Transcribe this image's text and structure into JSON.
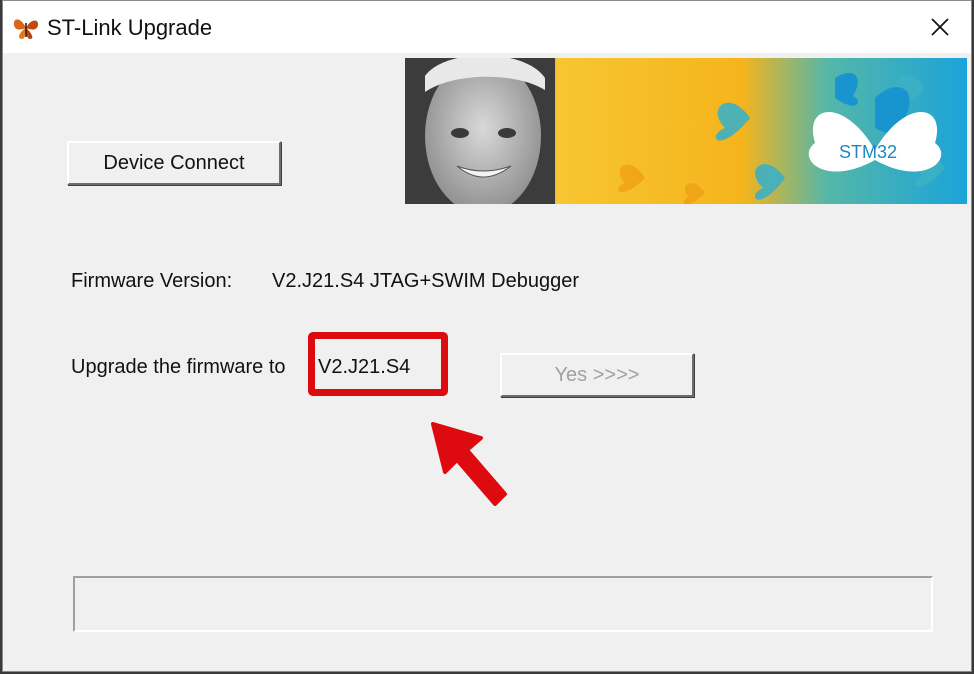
{
  "window": {
    "title": "ST-Link Upgrade",
    "close_symbol": "×"
  },
  "buttons": {
    "device_connect": "Device Connect",
    "yes": "Yes >>>>"
  },
  "firmware": {
    "label": "Firmware Version:",
    "value": "V2.J21.S4 JTAG+SWIM Debugger"
  },
  "upgrade": {
    "label": "Upgrade the firmware to",
    "target_version": "V2.J21.S4"
  },
  "banner": {
    "logo_text": "STM32"
  },
  "progress": {
    "fraction": 0
  },
  "colors": {
    "highlight": "#dd0a0f",
    "banner_yellow": "#f6b81e",
    "banner_blue": "#1ba3d9"
  },
  "icons": {
    "app": "butterfly-icon",
    "close": "close-icon",
    "arrow": "arrow-pointer-icon"
  }
}
